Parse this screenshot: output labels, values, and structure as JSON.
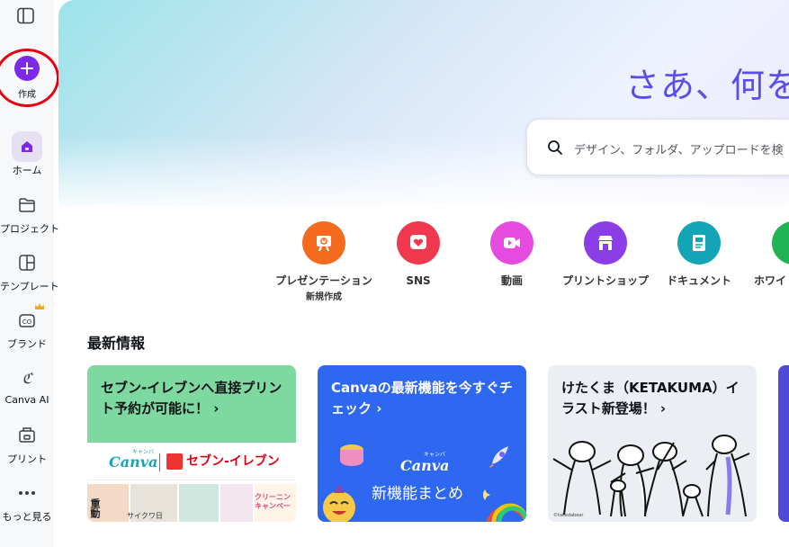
{
  "sidebar": {
    "create_label": "作成",
    "items": [
      {
        "label": "ホーム",
        "icon": "home-icon",
        "active": true
      },
      {
        "label": "プロジェクト",
        "icon": "folder-icon"
      },
      {
        "label": "テンプレート",
        "icon": "template-icon"
      },
      {
        "label": "ブランド",
        "icon": "brand-icon"
      },
      {
        "label": "Canva AI",
        "icon": "canva-ai-icon"
      },
      {
        "label": "プリント",
        "icon": "print-icon"
      },
      {
        "label": "もっと見る",
        "icon": "more-icon"
      }
    ]
  },
  "hero": {
    "title": "さあ、何を",
    "search_placeholder": "デザイン、フォルダ、アップロードを検"
  },
  "categories": [
    {
      "label": "プレゼンテーション",
      "sub": "新規作成",
      "icon": "presentation-icon",
      "color": "#f46b1f"
    },
    {
      "label": "SNS",
      "icon": "heart-icon",
      "color": "#f0394e"
    },
    {
      "label": "動画",
      "icon": "video-icon",
      "color": "#e64be0"
    },
    {
      "label": "プリントショップ",
      "icon": "shop-icon",
      "color": "#8b3de6"
    },
    {
      "label": "ドキュメント",
      "icon": "document-icon",
      "color": "#13a4b6"
    },
    {
      "label": "ホワイ",
      "icon": "whiteboard-icon",
      "color": "#21b253"
    }
  ],
  "news": {
    "title": "最新情報",
    "cards": [
      {
        "title": "セブン-イレブンへ直接プリント予約が可能に！ ›",
        "art": {
          "canva": "Canva",
          "canva_kana": "キャンバ",
          "partner": "セブン-イレブン",
          "t1": "重動",
          "t2": "サイクワ日",
          "t3": "クリーニン\nキャンペー"
        }
      },
      {
        "title": "Canvaの最新機能を今すぐチェック ›",
        "art": {
          "canva": "Canva",
          "canva_kana": "キャンバ",
          "sub": "新機能まとめ"
        }
      },
      {
        "title": "けたくま（KETAKUMA）イラスト新登場！ ›",
        "art": {
          "credit": "©takedabear"
        }
      }
    ]
  },
  "colors": {
    "accent": "#7d2ae8",
    "highlight_ring": "#e60012",
    "title": "#5b4de8"
  }
}
